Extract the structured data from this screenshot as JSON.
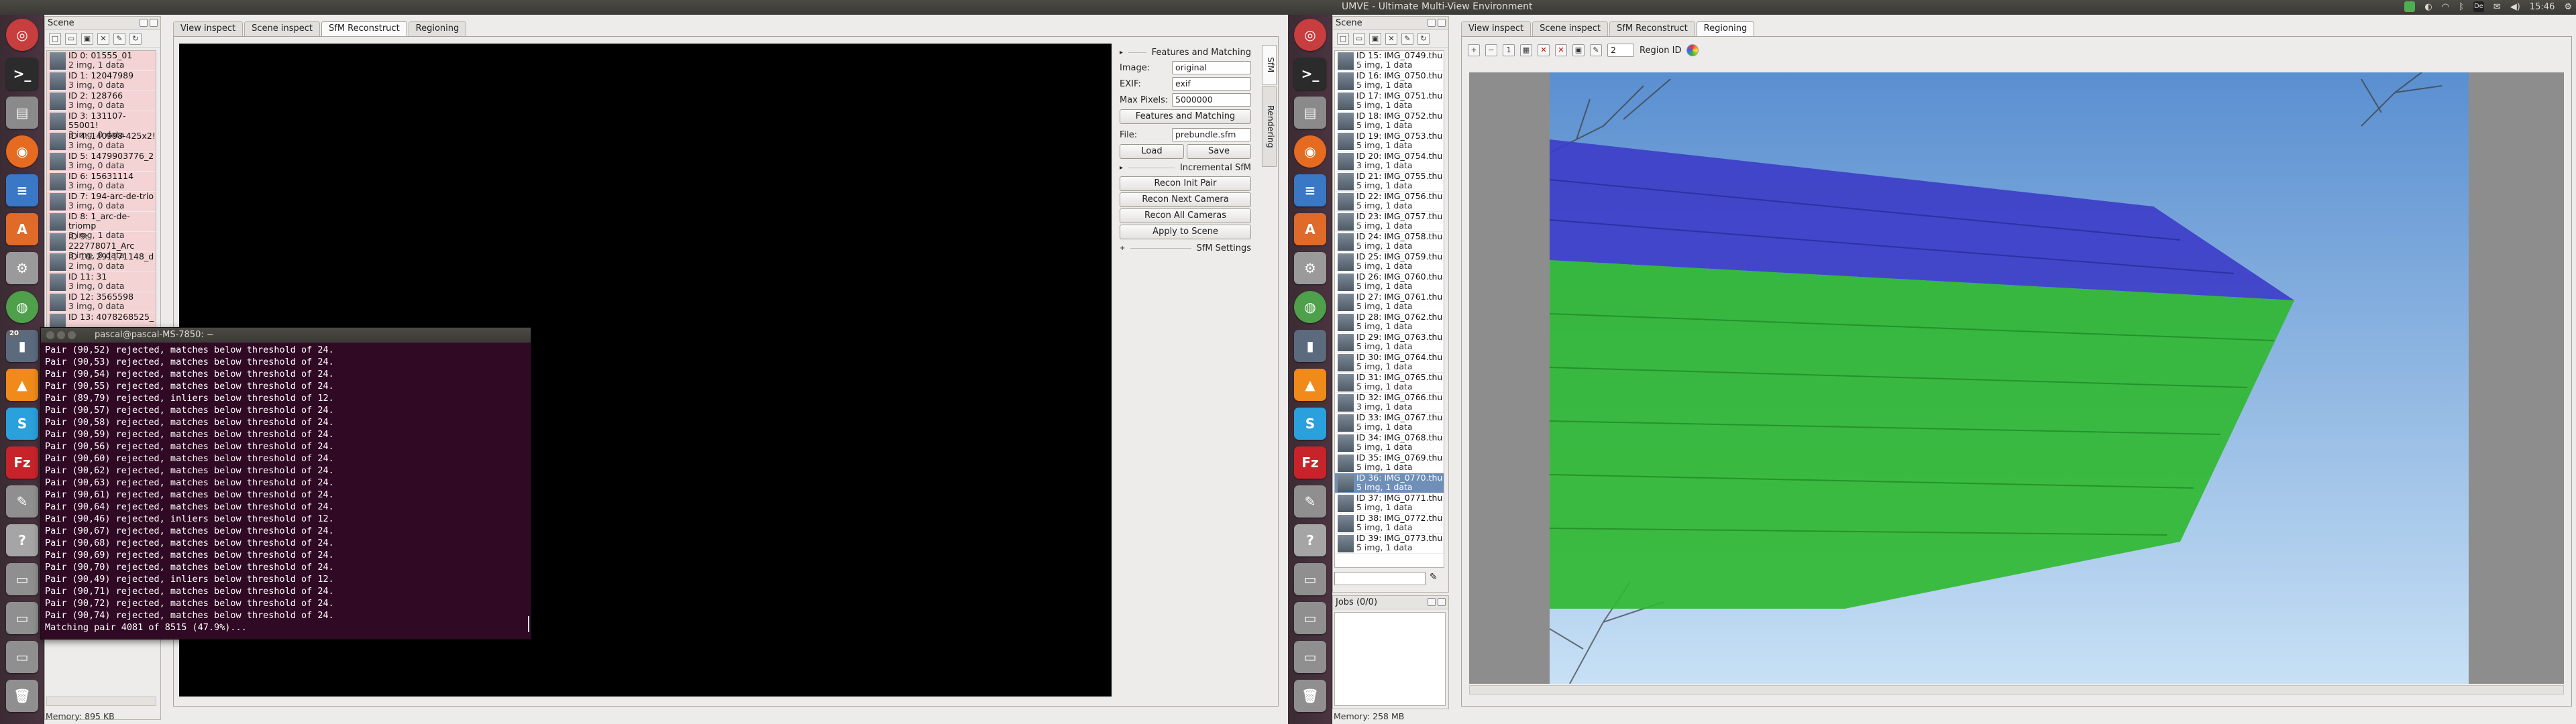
{
  "panel": {
    "title": "UMVE - Ultimate Multi-View Environment",
    "time": "15:46",
    "lang": "De"
  },
  "launcher": {
    "badge": "20"
  },
  "left": {
    "scene_title": "Scene",
    "views": [
      {
        "id": "ID 0: 01555_01",
        "info": "2 img, 1 data"
      },
      {
        "id": "ID 1: 12047989",
        "info": "3 img, 0 data"
      },
      {
        "id": "ID 2: 128766",
        "info": "3 img, 0 data"
      },
      {
        "id": "ID 3: 131107-55001!",
        "info": "3 img, 0 data"
      },
      {
        "id": "ID 4: 140998-425x2!",
        "info": "3 img, 0 data"
      },
      {
        "id": "ID 5: 1479903776_2",
        "info": "3 img, 0 data"
      },
      {
        "id": "ID 6: 15631114",
        "info": "3 img, 0 data"
      },
      {
        "id": "ID 7: 194-arc-de-trio",
        "info": "3 img, 0 data"
      },
      {
        "id": "ID 8: 1_arc-de-triomp",
        "info": "3 img, 1 data"
      },
      {
        "id": "ID 9: 222778071_Arc",
        "info": "3 img, 0 data"
      },
      {
        "id": "ID 10: 291171148_d",
        "info": "2 img, 0 data"
      },
      {
        "id": "ID 11: 31",
        "info": "3 img, 0 data"
      },
      {
        "id": "ID 12: 3565598",
        "info": "3 img, 0 data"
      },
      {
        "id": "ID 13: 4078268525_",
        "info": ""
      }
    ],
    "memory": "Memory: 895 KB",
    "tabs": [
      "View inspect",
      "Scene inspect",
      "SfM Reconstruct",
      "Regioning"
    ],
    "sfm": {
      "features_heading": "Features and Matching",
      "image_label": "Image:",
      "image_value": "original",
      "exif_label": "EXIF:",
      "exif_value": "exif",
      "maxpix_label": "Max Pixels:",
      "maxpix_value": "5000000",
      "features_btn": "Features and Matching",
      "file_label": "File:",
      "file_value": "prebundle.sfm",
      "load_btn": "Load",
      "save_btn": "Save",
      "incremental_heading": "Incremental SfM",
      "recon_init": "Recon Init Pair",
      "recon_next": "Recon Next Camera",
      "recon_all": "Recon All Cameras",
      "apply": "Apply to Scene",
      "settings": "SfM Settings",
      "vtab_sfm": "SfM",
      "vtab_render": "Rendering"
    }
  },
  "terminal": {
    "title": "pascal@pascal-MS-7850: ~",
    "lines": [
      "Pair (90,52) rejected, matches below threshold of 24.",
      "Pair (90,53) rejected, matches below threshold of 24.",
      "Pair (90,54) rejected, matches below threshold of 24.",
      "Pair (90,55) rejected, matches below threshold of 24.",
      "Pair (89,79) rejected, inliers below threshold of 12.",
      "Pair (90,57) rejected, matches below threshold of 24.",
      "Pair (90,58) rejected, matches below threshold of 24.",
      "Pair (90,59) rejected, matches below threshold of 24.",
      "Pair (90,56) rejected, matches below threshold of 24.",
      "Pair (90,60) rejected, matches below threshold of 24.",
      "Pair (90,62) rejected, matches below threshold of 24.",
      "Pair (90,63) rejected, matches below threshold of 24.",
      "Pair (90,61) rejected, matches below threshold of 24.",
      "Pair (90,64) rejected, matches below threshold of 24.",
      "Pair (90,46) rejected, inliers below threshold of 12.",
      "Pair (90,67) rejected, matches below threshold of 24.",
      "Pair (90,68) rejected, matches below threshold of 24.",
      "Pair (90,69) rejected, matches below threshold of 24.",
      "Pair (90,70) rejected, matches below threshold of 24.",
      "Pair (90,49) rejected, inliers below threshold of 12.",
      "Pair (90,71) rejected, matches below threshold of 24.",
      "Pair (90,72) rejected, matches below threshold of 24.",
      "Pair (90,74) rejected, matches below threshold of 24.",
      "Matching pair 4081 of 8515 (47.9%)..."
    ]
  },
  "right": {
    "scene_title": "Scene",
    "views": [
      {
        "id": "ID 15: IMG_0749.thu",
        "info": "5 img, 1 data"
      },
      {
        "id": "ID 16: IMG_0750.thu",
        "info": "5 img, 1 data"
      },
      {
        "id": "ID 17: IMG_0751.thu",
        "info": "5 img, 1 data"
      },
      {
        "id": "ID 18: IMG_0752.thu",
        "info": "5 img, 1 data"
      },
      {
        "id": "ID 19: IMG_0753.thu",
        "info": "5 img, 1 data"
      },
      {
        "id": "ID 20: IMG_0754.thu",
        "info": "3 img, 1 data"
      },
      {
        "id": "ID 21: IMG_0755.thu",
        "info": "5 img, 1 data"
      },
      {
        "id": "ID 22: IMG_0756.thu",
        "info": "5 img, 1 data"
      },
      {
        "id": "ID 23: IMG_0757.thu",
        "info": "5 img, 1 data"
      },
      {
        "id": "ID 24: IMG_0758.thu",
        "info": "5 img, 1 data"
      },
      {
        "id": "ID 25: IMG_0759.thu",
        "info": "5 img, 1 data"
      },
      {
        "id": "ID 26: IMG_0760.thu",
        "info": "5 img, 1 data"
      },
      {
        "id": "ID 27: IMG_0761.thu",
        "info": "5 img, 1 data"
      },
      {
        "id": "ID 28: IMG_0762.thu",
        "info": "5 img, 1 data"
      },
      {
        "id": "ID 29: IMG_0763.thu",
        "info": "5 img, 1 data"
      },
      {
        "id": "ID 30: IMG_0764.thu",
        "info": "5 img, 1 data"
      },
      {
        "id": "ID 31: IMG_0765.thu",
        "info": "5 img, 1 data"
      },
      {
        "id": "ID 32: IMG_0766.thu",
        "info": "3 img, 1 data"
      },
      {
        "id": "ID 33: IMG_0767.thu",
        "info": "5 img, 1 data"
      },
      {
        "id": "ID 34: IMG_0768.thu",
        "info": "5 img, 1 data"
      },
      {
        "id": "ID 35: IMG_0769.thu",
        "info": "5 img, 1 data"
      },
      {
        "id": "ID 36: IMG_0770.thu",
        "info": "5 img, 1 data"
      },
      {
        "id": "ID 37: IMG_0771.thu",
        "info": "5 img, 1 data"
      },
      {
        "id": "ID 38: IMG_0772.thu",
        "info": "5 img, 1 data"
      },
      {
        "id": "ID 39: IMG_0773.thu",
        "info": "5 img, 1 data"
      }
    ],
    "selected_index": 21,
    "jobs": "Jobs (0/0)",
    "memory": "Memory: 258 MB",
    "tabs": [
      "View inspect",
      "Scene inspect",
      "SfM Reconstruct",
      "Regioning"
    ],
    "region_label": "Region ID",
    "region_value": "2"
  },
  "colors": {
    "region_blue": "#3c3cc8",
    "region_green": "#2fb82f",
    "sky": "#b9d6ef"
  }
}
